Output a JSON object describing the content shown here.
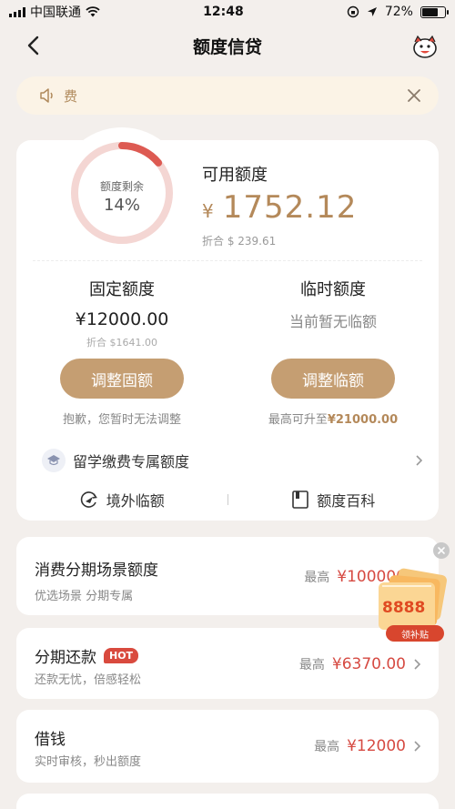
{
  "status_bar": {
    "carrier": "中国联通",
    "time": "12:48",
    "battery": "72%",
    "battery_level": 0.72
  },
  "nav": {
    "title": "额度信贷",
    "back_icon": "chevron-left-icon",
    "mascot_icon": "mascot-icon"
  },
  "notice": {
    "text": "费",
    "speaker_icon": "speaker-icon",
    "close_icon": "close-icon"
  },
  "credit": {
    "ring_label": "额度剩余",
    "ring_percent": "14%",
    "ring_fraction": 0.14,
    "available_label": "可用额度",
    "currency": "¥",
    "available_amount": "1752.12",
    "available_equiv": "折合 $ 239.61",
    "fixed": {
      "title": "固定额度",
      "value": "¥12000.00",
      "equiv": "折合 $1641.00",
      "button": "调整固额",
      "note": "抱歉，您暂时无法调整"
    },
    "temp": {
      "title": "临时额度",
      "value": "当前暂无临额",
      "button": "调整临额",
      "note_prefix": "最高可升至",
      "note_amount": "¥21000.00"
    },
    "study_label": "留学缴费专属额度",
    "links": [
      "境外临额",
      "额度百科"
    ]
  },
  "list": [
    {
      "title": "消费分期场景额度",
      "subtitle": "优选场景 分期专属",
      "prefix": "最高",
      "amount": "¥100000",
      "badge": ""
    },
    {
      "title": "分期还款",
      "subtitle": "还款无忧，倍感轻松",
      "prefix": "最高",
      "amount": "¥6370.00",
      "badge": "HOT"
    },
    {
      "title": "借钱",
      "subtitle": "实时审核，秒出额度",
      "prefix": "最高",
      "amount": "¥12000",
      "badge": ""
    }
  ],
  "floating": {
    "number": "8888",
    "label": "领补贴"
  },
  "colors": {
    "accent": "#c59e72",
    "amount_red": "#d64a42",
    "ring_red": "#dd5a52",
    "ring_bg": "#f4d6d3",
    "page_bg": "#f3efec"
  }
}
